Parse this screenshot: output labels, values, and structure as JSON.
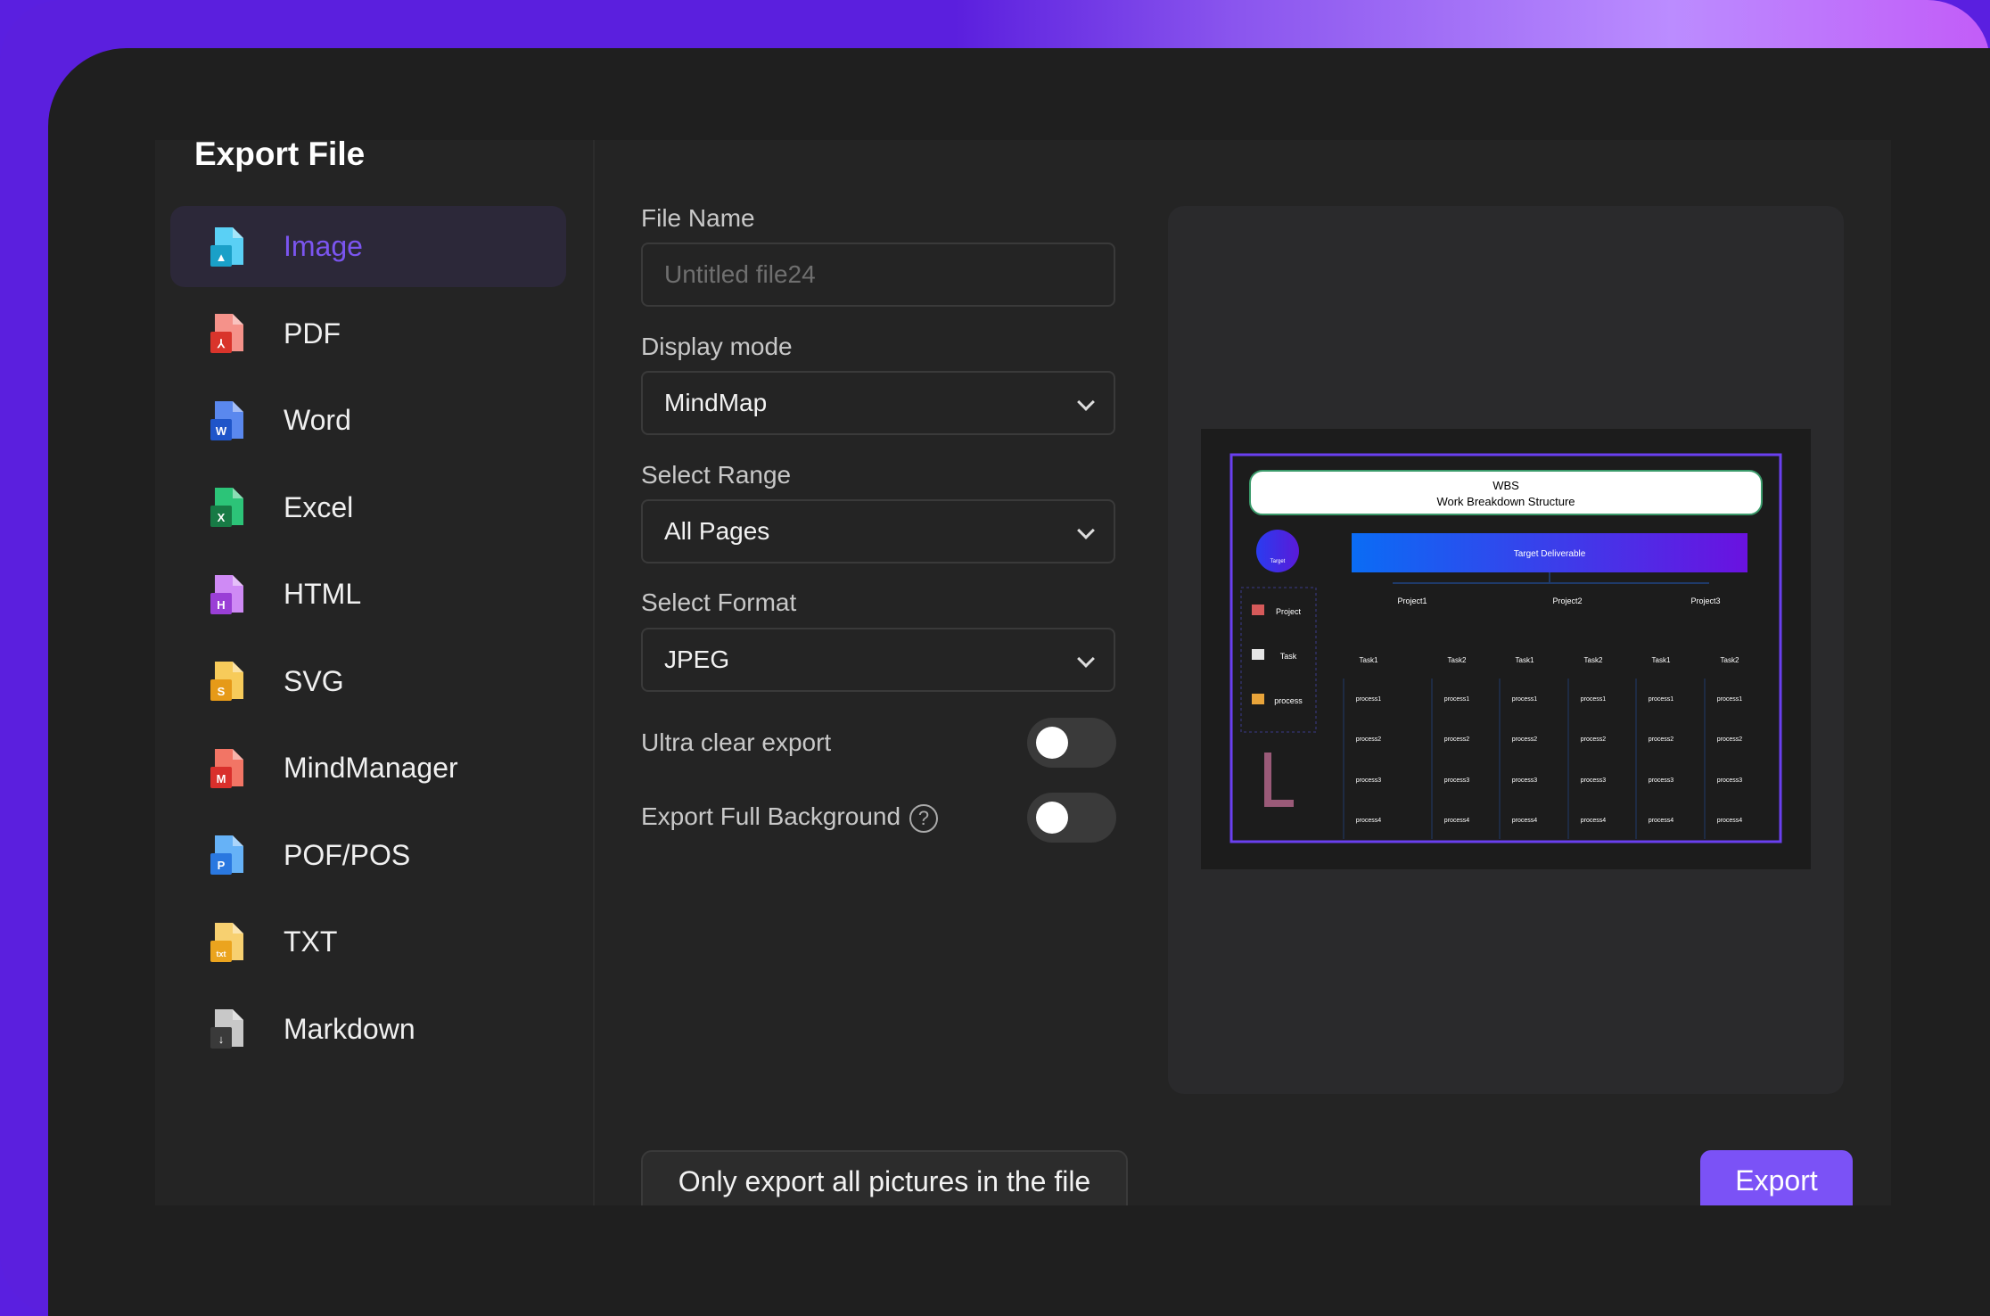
{
  "dialog": {
    "title": "Export File"
  },
  "accent_color": "#7b52f6",
  "sidebar": {
    "items": [
      {
        "label": "Image",
        "icon": "image-file-icon",
        "color": "#5ad0f5",
        "badge": "#1aa0c8",
        "glyph": "▲",
        "active": true
      },
      {
        "label": "PDF",
        "icon": "pdf-file-icon",
        "color": "#f5928a",
        "badge": "#d9342b",
        "glyph": "⅄"
      },
      {
        "label": "Word",
        "icon": "word-file-icon",
        "color": "#5a88ee",
        "badge": "#1f55c9",
        "glyph": "W"
      },
      {
        "label": "Excel",
        "icon": "excel-file-icon",
        "color": "#2cc478",
        "badge": "#177a45",
        "glyph": "X"
      },
      {
        "label": "HTML",
        "icon": "html-file-icon",
        "color": "#cf8af5",
        "badge": "#9a3fd6",
        "glyph": "H"
      },
      {
        "label": "SVG",
        "icon": "svg-file-icon",
        "color": "#f7cb5a",
        "badge": "#e69a18",
        "glyph": "S"
      },
      {
        "label": "MindManager",
        "icon": "mindmanager-file-icon",
        "color": "#f27565",
        "badge": "#d9302c",
        "glyph": "M"
      },
      {
        "label": "POF/POS",
        "icon": "pof-file-icon",
        "color": "#66b2f7",
        "badge": "#2a78e0",
        "glyph": "P"
      },
      {
        "label": "TXT",
        "icon": "txt-file-icon",
        "color": "#f7d070",
        "badge": "#eba41e",
        "glyph": "txt"
      },
      {
        "label": "Markdown",
        "icon": "markdown-file-icon",
        "color": "#c8c8c8",
        "badge": "#3a3a3a",
        "glyph": "↓"
      }
    ]
  },
  "form": {
    "file_name_label": "File Name",
    "file_name_value": "",
    "file_name_placeholder": "Untitled file24",
    "display_mode_label": "Display mode",
    "display_mode_value": "MindMap",
    "range_label": "Select Range",
    "range_value": "All Pages",
    "format_label": "Select Format",
    "format_value": "JPEG",
    "ultra_clear_label": "Ultra clear export",
    "ultra_clear_on": false,
    "full_bg_label": "Export Full Background",
    "full_bg_help": "?",
    "full_bg_on": false
  },
  "preview": {
    "title": "WBS",
    "subtitle": "Work Breakdown Structure",
    "target": "Target",
    "deliverable": "Target Deliverable",
    "legend": [
      "Project",
      "Task",
      "process"
    ],
    "projects": [
      "Project1",
      "Project2",
      "Project3"
    ],
    "tasks": [
      "Task1",
      "Task2",
      "Task1",
      "Task2",
      "Task1",
      "Task2"
    ],
    "processes": [
      "process1",
      "process2",
      "process3",
      "process4"
    ]
  },
  "footer": {
    "only_pictures_label": "Only export all pictures in the file",
    "export_label": "Export"
  }
}
